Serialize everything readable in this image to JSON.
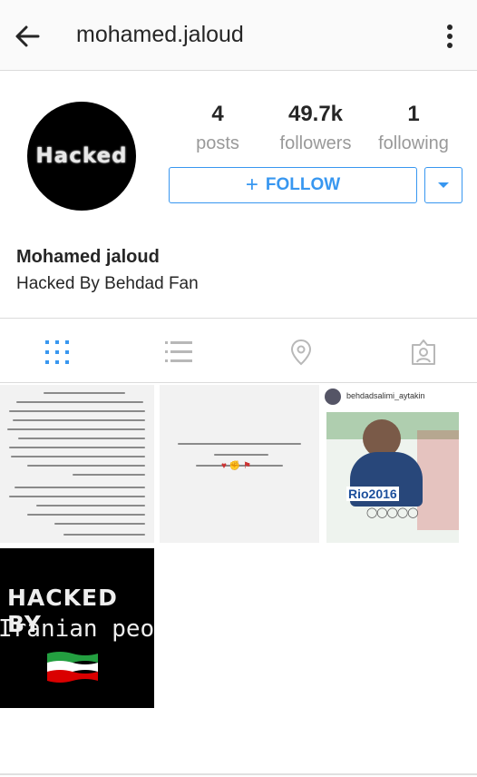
{
  "header": {
    "username": "mohamed.jaloud",
    "back_icon": "arrow-left-icon",
    "menu_icon": "more-vertical-icon"
  },
  "profile": {
    "avatar_text": "Hacked",
    "stats": [
      {
        "value": "4",
        "label": "posts"
      },
      {
        "value": "49.7k",
        "label": "followers"
      },
      {
        "value": "1",
        "label": "following"
      }
    ],
    "follow_label": "FOLLOW",
    "follow_icon": "plus-icon",
    "dropdown_icon": "caret-down-icon",
    "display_name": "Mohamed jaloud",
    "bio": "Hacked By Behdad Fan"
  },
  "tabs": [
    {
      "name": "grid",
      "icon": "grid-icon",
      "active": true
    },
    {
      "name": "list",
      "icon": "list-icon",
      "active": false
    },
    {
      "name": "map",
      "icon": "location-pin-icon",
      "active": false
    },
    {
      "name": "tagged",
      "icon": "tagged-person-icon",
      "active": false
    }
  ],
  "posts": [
    {
      "type": "text",
      "description": "Persian text post"
    },
    {
      "type": "text",
      "description": "Persian text post with emoji"
    },
    {
      "type": "image",
      "account": "behdadsalimi_aytakin",
      "caption_logo": "Rio2016"
    },
    {
      "type": "image",
      "line1": "HACKED BY",
      "line2": "Iranian people"
    }
  ],
  "colors": {
    "accent": "#3897f0",
    "muted": "#999999",
    "border": "#dbdbdb",
    "text": "#262626"
  }
}
